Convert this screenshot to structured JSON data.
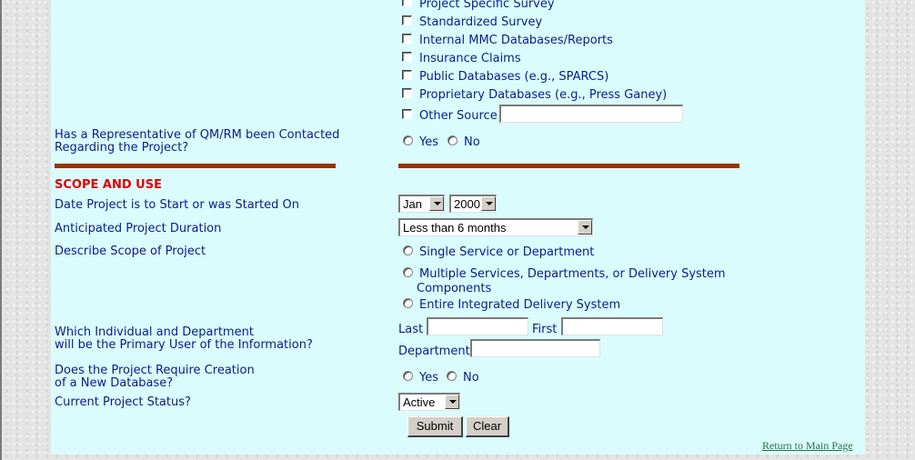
{
  "data_sources": [
    {
      "label": "Project Specific Survey"
    },
    {
      "label": "Standardized Survey"
    },
    {
      "label": "Internal MMC Databases/Reports"
    },
    {
      "label": "Insurance Claims"
    },
    {
      "label": "Public Databases (e.g., SPARCS)"
    },
    {
      "label": "Proprietary Databases (e.g., Press Ganey)"
    },
    {
      "label": "Other Source"
    }
  ],
  "qm_question": {
    "line1": "Has a Representative of QM/RM been Contacted",
    "line2": "Regarding the Project?",
    "yes": "Yes",
    "no": "No"
  },
  "scope": {
    "heading": "SCOPE AND USE",
    "date_label": "Date Project is to Start or was Started On",
    "month": "Jan",
    "year": "2000",
    "duration_label": "Anticipated Project Duration",
    "duration_value": "Less than 6 months",
    "describe_label": "Describe Scope of Project",
    "option1": "Single Service or Department",
    "option2_line1": "Multiple Services, Departments, or Delivery System",
    "option2_line2": "Components",
    "option3": "Entire Integrated Delivery System",
    "user_line1": "Which Individual and Department",
    "user_line2": "will be the Primary User of the Information?",
    "last_label": "Last",
    "first_label": "First",
    "dept_label": "Department",
    "db_line1": "Does the Project Require Creation",
    "db_line2": "of a New Database?",
    "db_yes": "Yes",
    "db_no": "No",
    "status_label": "Current Project Status?",
    "status_value": "Active"
  },
  "actions": {
    "submit": "Submit",
    "clear": "Clear",
    "return_link": "Return to Main Page"
  }
}
